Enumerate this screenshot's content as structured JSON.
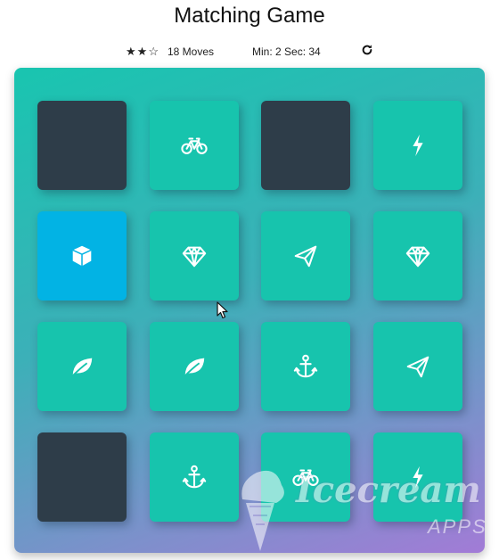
{
  "title": "Matching Game",
  "score_panel": {
    "star_rating": 2,
    "star_max": 3,
    "moves": "18 Moves",
    "timer": "Min: 2 Sec: 34",
    "restart_icon": "repeat-icon"
  },
  "deck": {
    "rows": 4,
    "cols": 4,
    "cards": [
      {
        "state": "hidden",
        "icon": ""
      },
      {
        "state": "match",
        "icon": "bicycle"
      },
      {
        "state": "hidden",
        "icon": ""
      },
      {
        "state": "match",
        "icon": "bolt"
      },
      {
        "state": "open",
        "icon": "cube"
      },
      {
        "state": "match",
        "icon": "diamond"
      },
      {
        "state": "match",
        "icon": "paper-plane"
      },
      {
        "state": "match",
        "icon": "diamond"
      },
      {
        "state": "match",
        "icon": "leaf"
      },
      {
        "state": "match",
        "icon": "leaf"
      },
      {
        "state": "match",
        "icon": "anchor"
      },
      {
        "state": "match",
        "icon": "paper-plane"
      },
      {
        "state": "hidden",
        "icon": ""
      },
      {
        "state": "match",
        "icon": "anchor"
      },
      {
        "state": "match",
        "icon": "bicycle"
      },
      {
        "state": "match",
        "icon": "bolt"
      }
    ]
  },
  "colors": {
    "hidden": "#2e3d49",
    "match": "#17c4ad",
    "open": "#02b3e4"
  },
  "watermark": {
    "brand": "Icecream",
    "sub": "APPS"
  }
}
